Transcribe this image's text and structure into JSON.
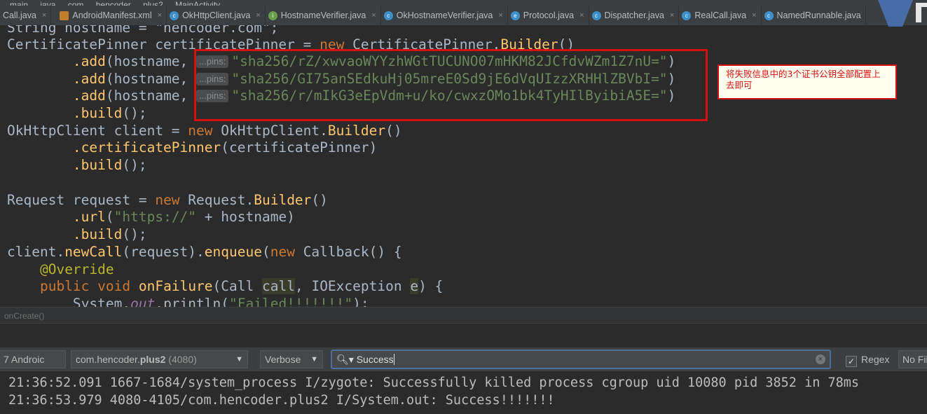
{
  "breadcrumb": [
    "main",
    "java",
    "com",
    "hencoder",
    "plus2",
    "MainActivity"
  ],
  "tabs": [
    {
      "label": "Call.java",
      "icon": "interface-icon"
    },
    {
      "label": "AndroidManifest.xml",
      "icon": "xml-icon"
    },
    {
      "label": "OkHttpClient.java",
      "icon": "class-icon"
    },
    {
      "label": "HostnameVerifier.java",
      "icon": "interface-icon"
    },
    {
      "label": "OkHostnameVerifier.java",
      "icon": "class-icon"
    },
    {
      "label": "Protocol.java",
      "icon": "enum-icon"
    },
    {
      "label": "Dispatcher.java",
      "icon": "class-icon"
    },
    {
      "label": "RealCall.java",
      "icon": "class-icon"
    },
    {
      "label": "NamedRunnable.java",
      "icon": "class-icon"
    }
  ],
  "code": {
    "l0": "String hostname = \"hencoder.com\";",
    "l1_type": "CertificatePinner certificatePinner = ",
    "l1_new": "new",
    "l1_cls": " CertificatePinner.",
    "l1_builder": "Builder",
    "l1_end": "()",
    "add": ".add",
    "add_args": "(hostname, ",
    "pins_hint": "...pins:",
    "pin1": "\"sha256/rZ/xwvaoWYYzhWGtTUCUNO07mHKM82JCfdvWZm1Z7nU=\"",
    "pin2": "\"sha256/GI75anSEdkuHj05mreE0Sd9jE6dVqUIzzXRHHlZBVbI=\"",
    "pin3": "\"sha256/r/mIkG3eEpVdm+u/ko/cwxzOMo1bk4TyHIlByibiA5E=\"",
    "close_paren": ")",
    "build": ".build",
    "build_end": "();",
    "client_decl": "OkHttpClient client = ",
    "new": "new",
    "client_cls": " OkHttpClient.",
    "builder": "Builder",
    "parens": "()",
    "certificatePinner": ".certificatePinner",
    "cp_arg": "(certificatePinner)",
    "req_decl": "Request request = ",
    "req_cls": " Request.",
    "url": ".url",
    "url_open": "(",
    "url_str": "\"https://\"",
    "url_rest": " + hostname)",
    "client_prefix": "client.",
    "newCall": "newCall",
    "req_arg": "(request).",
    "enqueue": "enqueue",
    "enq_open": "(",
    "callback": " Callback() {",
    "override": "@Override",
    "public": "public",
    "void": " void ",
    "onFailure": "onFailure",
    "failure_args_a": "(Call ",
    "call": "call",
    "failure_args_b": ", IOException ",
    "e": "e",
    "failure_args_c": ") {",
    "println_a": "System.",
    "out": "out",
    "println_b": ".println(",
    "failed_str": "\"Failed!!!!!!!\"",
    "println_c": ");"
  },
  "annotation": {
    "text": "将失败信息中的3个证书公钥全部配置上去即可"
  },
  "structure_bar": {
    "label": "onCreate()"
  },
  "logcat": {
    "device": "7 Androic",
    "process": "com.hencoder.",
    "process_bold": "plus2",
    "process_pid": " (4080)",
    "level": "Verbose",
    "search_value": "Success",
    "regex_label": "Regex",
    "regex_checked": "✓",
    "filter": "No Fil",
    "lines": [
      "21:36:52.091 1667-1684/system_process I/zygote: Successfully killed process cgroup uid 10080 pid 3852 in 78ms",
      "21:36:53.979 4080-4105/com.hencoder.plus2 I/System.out: Success!!!!!!!"
    ]
  },
  "colors": {
    "accent": "#d41010",
    "editor_bg": "#2b2b2b",
    "keyword": "#cc7832",
    "string": "#6a8759",
    "method": "#ffc66d"
  }
}
